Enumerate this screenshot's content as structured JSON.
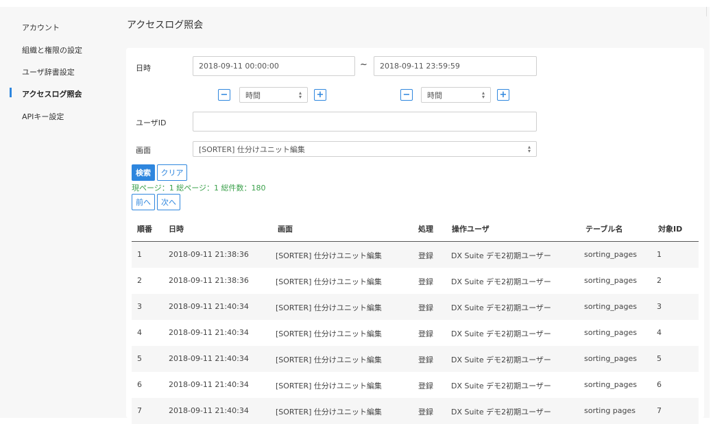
{
  "sidebar": {
    "items": [
      {
        "label": "アカウント"
      },
      {
        "label": "組織と権限の設定"
      },
      {
        "label": "ユーザ辞書設定"
      },
      {
        "label": "アクセスログ照会"
      },
      {
        "label": "APIキー設定"
      }
    ],
    "active_index": 3
  },
  "page": {
    "title": "アクセスログ照会"
  },
  "form": {
    "datetime_label": "日時",
    "start_value": "2018-09-11 00:00:00",
    "range_separator": "~",
    "end_value": "2018-09-11 23:59:59",
    "minus": "−",
    "plus": "+",
    "unit_select_value_start": "時間",
    "unit_select_value_end": "時間",
    "userid_label": "ユーザID",
    "userid_value": "",
    "screen_label": "画面",
    "screen_value": "[SORTER] 仕分けユニット編集",
    "search_label": "検索",
    "clear_label": "クリア"
  },
  "pager": {
    "info": "現ページ：1 総ページ：1 総件数：180",
    "prev_label": "前へ",
    "next_label": "次へ"
  },
  "table": {
    "columns": [
      "順番",
      "日時",
      "画面",
      "処理",
      "操作ユーザ",
      "テーブル名",
      "対象ID"
    ],
    "rows": [
      [
        "1",
        "2018-09-11 21:38:36",
        "[SORTER] 仕分けユニット編集",
        "登録",
        "DX Suite デモ2初期ユーザー",
        "sorting_pages",
        "1"
      ],
      [
        "2",
        "2018-09-11 21:38:36",
        "[SORTER] 仕分けユニット編集",
        "登録",
        "DX Suite デモ2初期ユーザー",
        "sorting_pages",
        "2"
      ],
      [
        "3",
        "2018-09-11 21:40:34",
        "[SORTER] 仕分けユニット編集",
        "登録",
        "DX Suite デモ2初期ユーザー",
        "sorting_pages",
        "3"
      ],
      [
        "4",
        "2018-09-11 21:40:34",
        "[SORTER] 仕分けユニット編集",
        "登録",
        "DX Suite デモ2初期ユーザー",
        "sorting_pages",
        "4"
      ],
      [
        "5",
        "2018-09-11 21:40:34",
        "[SORTER] 仕分けユニット編集",
        "登録",
        "DX Suite デモ2初期ユーザー",
        "sorting_pages",
        "5"
      ],
      [
        "6",
        "2018-09-11 21:40:34",
        "[SORTER] 仕分けユニット編集",
        "登録",
        "DX Suite デモ2初期ユーザー",
        "sorting_pages",
        "6"
      ],
      [
        "7",
        "2018-09-11 21:40:34",
        "[SORTER] 仕分けユニット編集",
        "登録",
        "DX Suite デモ2初期ユーザー",
        "sorting pages",
        "7"
      ]
    ]
  },
  "colors": {
    "accent": "#2e86de",
    "pager_info": "#3aa04a",
    "background": "#f7f7f7"
  }
}
